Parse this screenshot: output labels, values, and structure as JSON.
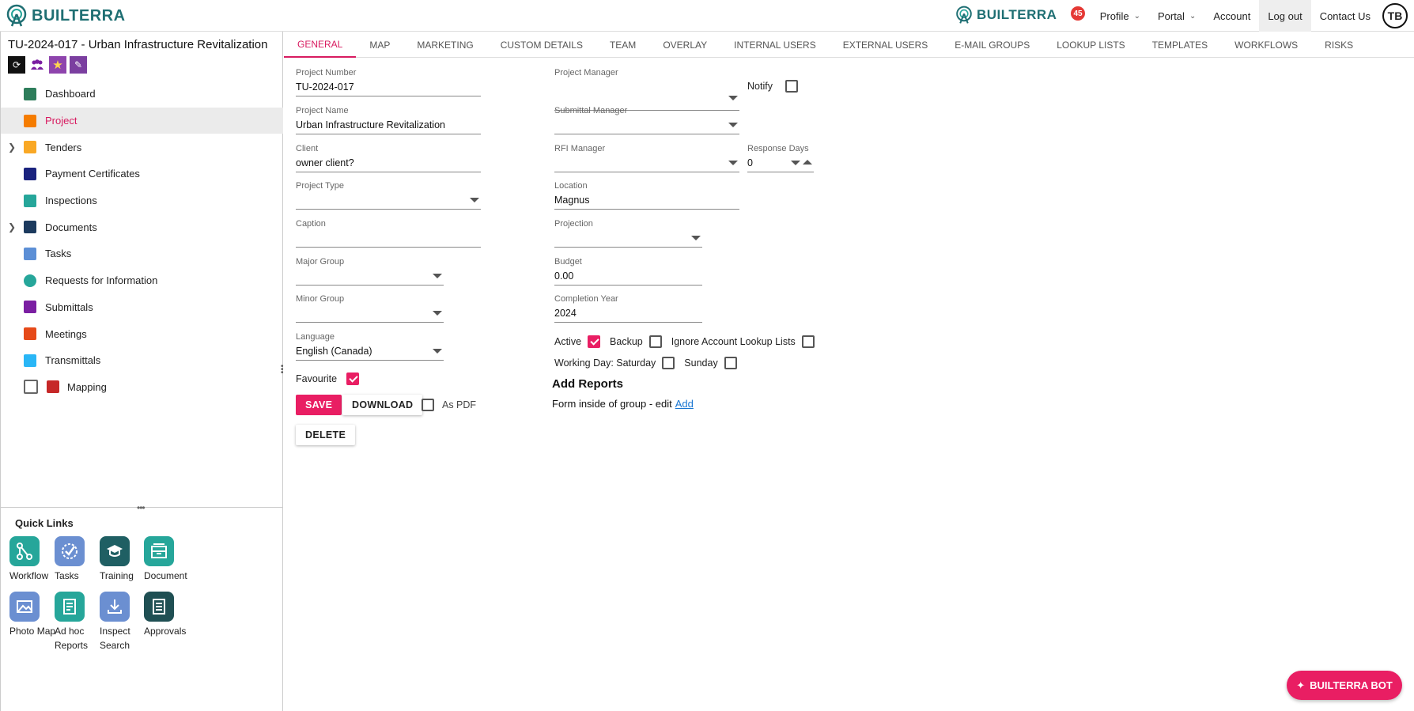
{
  "brand": {
    "name": "BUILTERRA",
    "accent": "#e91e63",
    "teal": "#1f6f73"
  },
  "topnav": {
    "badge_count": "45",
    "profile": "Profile",
    "portal": "Portal",
    "account": "Account",
    "logout": "Log out",
    "contact": "Contact Us",
    "avatar": "TB"
  },
  "project": {
    "title": "TU-2024-017 - Urban Infrastructure Revitalization"
  },
  "sidebar": {
    "items": [
      {
        "label": "Dashboard",
        "color": "#2e7d5b"
      },
      {
        "label": "Project",
        "color": "#f57c00"
      },
      {
        "label": "Tenders",
        "color": "#f9a825"
      },
      {
        "label": "Payment Certificates",
        "color": "#1a237e"
      },
      {
        "label": "Inspections",
        "color": "#26a69a"
      },
      {
        "label": "Documents",
        "color": "#1c3a5e"
      },
      {
        "label": "Tasks",
        "color": "#5c8fd6"
      },
      {
        "label": "Requests for Information",
        "color": "#26a69a"
      },
      {
        "label": "Submittals",
        "color": "#7b1fa2"
      },
      {
        "label": "Meetings",
        "color": "#e64a19"
      },
      {
        "label": "Transmittals",
        "color": "#29b6f6"
      },
      {
        "label": "Mapping",
        "color": "#c62828"
      }
    ]
  },
  "quick_links": {
    "title": "Quick Links",
    "items": [
      {
        "label": "Workflow",
        "color": "#26a69a"
      },
      {
        "label": "Tasks",
        "color": "#6b8fd1"
      },
      {
        "label": "Training",
        "color": "#1f5f63"
      },
      {
        "label": "Document",
        "color": "#26a69a"
      },
      {
        "label": "Photo Map",
        "color": "#6b8fd1"
      },
      {
        "label": "Ad hoc Reports",
        "color": "#26a69a"
      },
      {
        "label": "Inspect Search",
        "color": "#6b8fd1"
      },
      {
        "label": "Approvals",
        "color": "#1f4f53"
      }
    ]
  },
  "tabs": [
    "GENERAL",
    "MAP",
    "MARKETING",
    "CUSTOM DETAILS",
    "TEAM",
    "OVERLAY",
    "INTERNAL USERS",
    "EXTERNAL USERS",
    "E-MAIL GROUPS",
    "LOOKUP LISTS",
    "TEMPLATES",
    "WORKFLOWS",
    "RISKS"
  ],
  "form": {
    "project_number": {
      "label": "Project Number",
      "value": "TU-2024-017"
    },
    "project_name": {
      "label": "Project Name",
      "value": "Urban Infrastructure Revitalization"
    },
    "client": {
      "label": "Client",
      "value": "owner client?"
    },
    "project_type": {
      "label": "Project Type",
      "value": ""
    },
    "caption": {
      "label": "Caption",
      "value": ""
    },
    "major_group": {
      "label": "Major Group",
      "value": ""
    },
    "minor_group": {
      "label": "Minor Group",
      "value": ""
    },
    "language": {
      "label": "Language",
      "value": "English (Canada)"
    },
    "favourite": {
      "label": "Favourite",
      "checked": true
    },
    "project_manager": {
      "label": "Project Manager",
      "value": ""
    },
    "notify": {
      "label": "Notify",
      "checked": false
    },
    "submittal_manager": {
      "label": "Submittal Manager",
      "value": ""
    },
    "rfi_manager": {
      "label": "RFI Manager",
      "value": ""
    },
    "response_days": {
      "label": "Response Days",
      "value": "0"
    },
    "location": {
      "label": "Location",
      "value": "Magnus"
    },
    "projection": {
      "label": "Projection",
      "value": ""
    },
    "budget": {
      "label": "Budget",
      "value": "0.00"
    },
    "completion_year": {
      "label": "Completion Year",
      "value": "2024"
    },
    "active": {
      "label": "Active",
      "checked": true
    },
    "backup": {
      "label": "Backup",
      "checked": false
    },
    "ignore_lookup": {
      "label": "Ignore Account Lookup Lists",
      "checked": false
    },
    "working_saturday": {
      "label": "Working Day: Saturday",
      "checked": false
    },
    "sunday": {
      "label": "Sunday",
      "checked": false
    },
    "as_pdf": {
      "label": "As PDF",
      "checked": false
    }
  },
  "buttons": {
    "save": "SAVE",
    "download": "DOWNLOAD",
    "delete": "DELETE"
  },
  "reports": {
    "title": "Add Reports",
    "text": "Form inside of group - edit",
    "add_link": "Add"
  },
  "bot": {
    "label": "BUILTERRA BOT"
  }
}
